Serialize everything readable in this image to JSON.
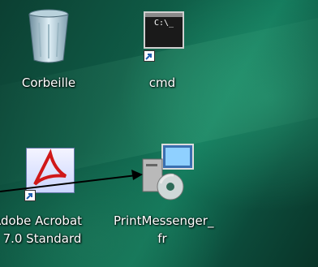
{
  "desktop": {
    "icons": [
      {
        "label": "Corbeille",
        "icon": "recycle-bin-icon"
      },
      {
        "label": "cmd",
        "icon": "cmd-icon",
        "console_text": "C:\\_"
      },
      {
        "label_line1": "Adobe Acrobat",
        "label_line2": "7.0 Standard",
        "icon": "adobe-acrobat-icon"
      },
      {
        "label_line1": "PrintMessenger_",
        "label_line2": "fr",
        "icon": "installer-icon"
      }
    ]
  },
  "colors": {
    "wallpaper": "#0f5a45",
    "acrobat_red": "#d01818",
    "label_text": "#ffffff"
  }
}
